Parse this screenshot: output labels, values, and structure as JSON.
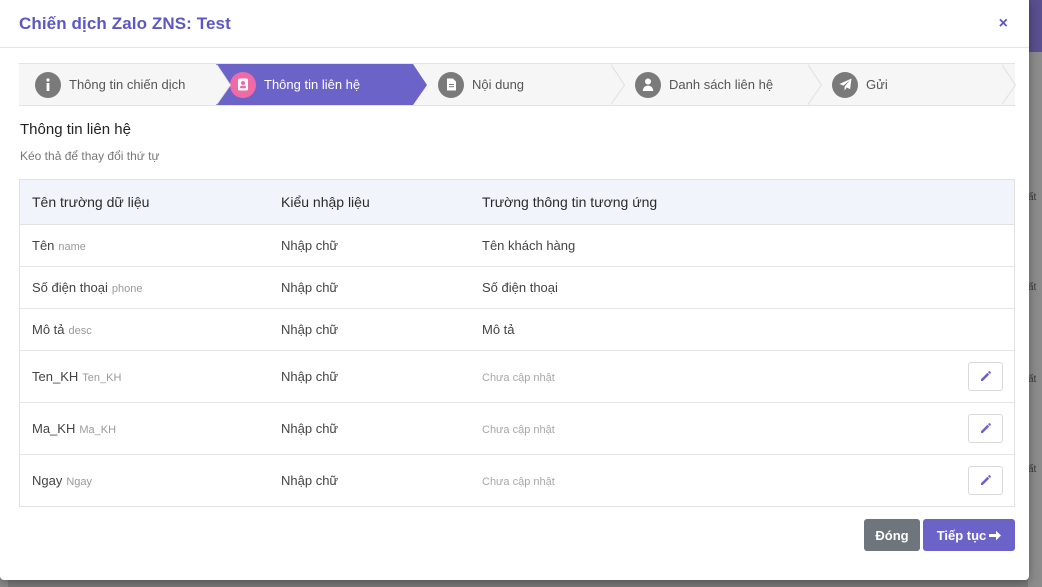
{
  "background": {
    "right_ticks": [
      "ất",
      "ất",
      "ất",
      "ất"
    ]
  },
  "modal": {
    "title": "Chiến dịch Zalo ZNS: Test",
    "close_icon": "×"
  },
  "stepper": {
    "steps": [
      {
        "label": "Thông tin chiến dịch",
        "icon": "info-icon",
        "glyph": "i",
        "active": false
      },
      {
        "label": "Thông tin liên hệ",
        "icon": "contact-card-icon",
        "glyph": "",
        "active": true
      },
      {
        "label": "Nội dung",
        "icon": "document-icon",
        "glyph": "",
        "active": false
      },
      {
        "label": "Danh sách liên hệ",
        "icon": "user-icon",
        "glyph": "",
        "active": false
      },
      {
        "label": "Gửi",
        "icon": "send-icon",
        "glyph": "",
        "active": false
      }
    ]
  },
  "section": {
    "title": "Thông tin liên hệ",
    "subtitle": "Kéo thả để thay đổi thứ tự"
  },
  "table": {
    "headers": [
      "Tên trường dữ liệu",
      "Kiểu nhập liệu",
      "Trường thông tin tương ứng"
    ],
    "rows": [
      {
        "name": "Tên",
        "key": "name",
        "input_type": "Nhập chữ",
        "mapped": "Tên khách hàng",
        "mapped_muted": false,
        "editable": false
      },
      {
        "name": "Số điện thoại",
        "key": "phone",
        "input_type": "Nhập chữ",
        "mapped": "Số điện thoại",
        "mapped_muted": false,
        "editable": false
      },
      {
        "name": "Mô tả",
        "key": "desc",
        "input_type": "Nhập chữ",
        "mapped": "Mô tả",
        "mapped_muted": false,
        "editable": false
      },
      {
        "name": "Ten_KH",
        "key": "Ten_KH",
        "input_type": "Nhập chữ",
        "mapped": "Chưa cập nhật",
        "mapped_muted": true,
        "editable": true
      },
      {
        "name": "Ma_KH",
        "key": "Ma_KH",
        "input_type": "Nhập chữ",
        "mapped": "Chưa cập nhật",
        "mapped_muted": true,
        "editable": true
      },
      {
        "name": "Ngay",
        "key": "Ngay",
        "input_type": "Nhập chữ",
        "mapped": "Chưa cập nhật",
        "mapped_muted": true,
        "editable": true
      }
    ]
  },
  "footer": {
    "close_label": "Đóng",
    "next_label": "Tiếp tục"
  },
  "colors": {
    "primary": "#6c63c9",
    "active_step_icon": "#f06aa6",
    "close_button": "#6e757c"
  }
}
